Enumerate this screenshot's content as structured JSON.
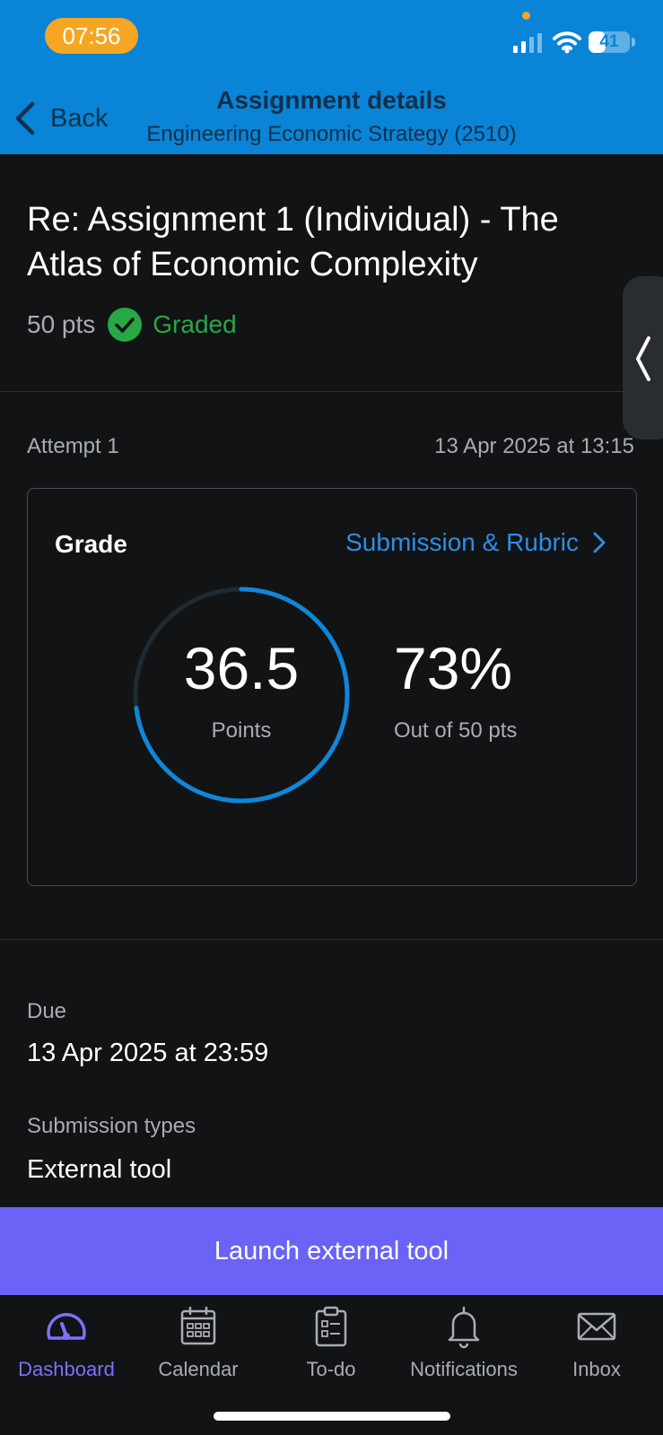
{
  "status_bar": {
    "time": "07:56",
    "battery": "41",
    "battery_level_percent": 41
  },
  "header": {
    "back_label": "Back",
    "title": "Assignment details",
    "subtitle": "Engineering Economic Strategy (2510)"
  },
  "assignment": {
    "title": "Re: Assignment 1 (Individual) - The Atlas of Economic Complexity",
    "points": "50 pts",
    "status": "Graded",
    "status_color": "#27a844"
  },
  "attempt": {
    "label": "Attempt 1",
    "date": "13 Apr 2025 at 13:15"
  },
  "grade": {
    "label": "Grade",
    "rubric_link": "Submission & Rubric",
    "points_value": "36.5",
    "points_label": "Points",
    "percent_value": "73%",
    "percent_label": "Out of 50 pts",
    "score_fraction": 0.73,
    "ring_color": "#0f86d8"
  },
  "details": {
    "due_label": "Due",
    "due_value": "13 Apr 2025 at 23:59",
    "submission_types_label": "Submission types",
    "submission_types_value": "External tool"
  },
  "launch_button": "Launch external tool",
  "tabs": [
    {
      "label": "Dashboard",
      "icon": "dashboard-icon",
      "active": true
    },
    {
      "label": "Calendar",
      "icon": "calendar-icon",
      "active": false
    },
    {
      "label": "To-do",
      "icon": "todo-icon",
      "active": false
    },
    {
      "label": "Notifications",
      "icon": "bell-icon",
      "active": false
    },
    {
      "label": "Inbox",
      "icon": "mail-icon",
      "active": false
    }
  ],
  "colors": {
    "header_bg": "#0a84d6",
    "accent_purple": "#6a63f6",
    "link_blue": "#2f8de6"
  }
}
